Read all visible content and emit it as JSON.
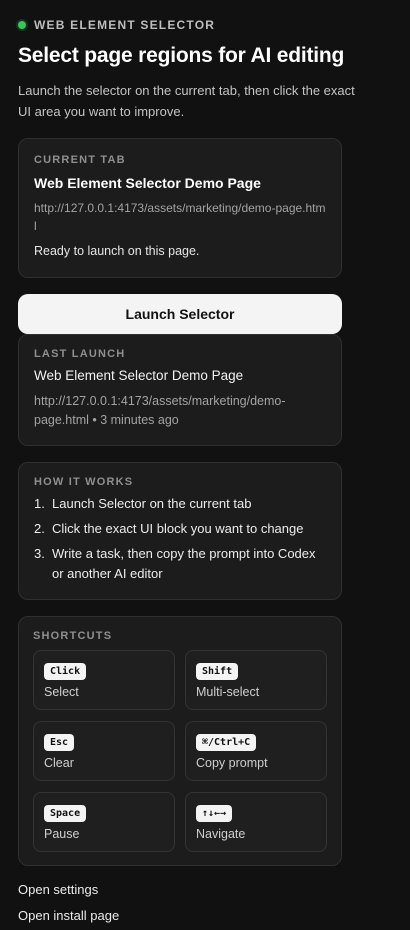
{
  "header": {
    "eyebrow": "WEB ELEMENT SELECTOR",
    "status_color": "#34c759",
    "title": "Select page regions for AI editing",
    "subtitle": "Launch the selector on the current tab, then click the exact UI area you want to improve."
  },
  "current_tab": {
    "label": "CURRENT TAB",
    "page_name": "Web Element Selector Demo Page",
    "url": "http://127.0.0.1:4173/assets/marketing/demo-page.html",
    "status": "Ready to launch on this page."
  },
  "launch_button": {
    "label": "Launch Selector"
  },
  "last_launch": {
    "label": "LAST LAUNCH",
    "page_name": "Web Element Selector Demo Page",
    "meta": "http://127.0.0.1:4173/assets/marketing/demo-page.html • 3 minutes ago"
  },
  "how_it_works": {
    "label": "HOW IT WORKS",
    "steps": [
      {
        "num": "1.",
        "text": "Launch Selector on the current tab"
      },
      {
        "num": "2.",
        "text": "Click the exact UI block you want to change"
      },
      {
        "num": "3.",
        "text": "Write a task, then copy the prompt into Codex or another AI editor"
      }
    ]
  },
  "shortcuts": {
    "label": "SHORTCUTS",
    "items": [
      {
        "key": "Click",
        "action": "Select"
      },
      {
        "key": "Shift",
        "action": "Multi-select"
      },
      {
        "key": "Esc",
        "action": "Clear"
      },
      {
        "key": "⌘/Ctrl+C",
        "action": "Copy prompt"
      },
      {
        "key": "Space",
        "action": "Pause"
      },
      {
        "key": "↑↓←→",
        "action": "Navigate"
      }
    ]
  },
  "footer": {
    "settings_link": "Open settings",
    "install_link": "Open install page"
  }
}
